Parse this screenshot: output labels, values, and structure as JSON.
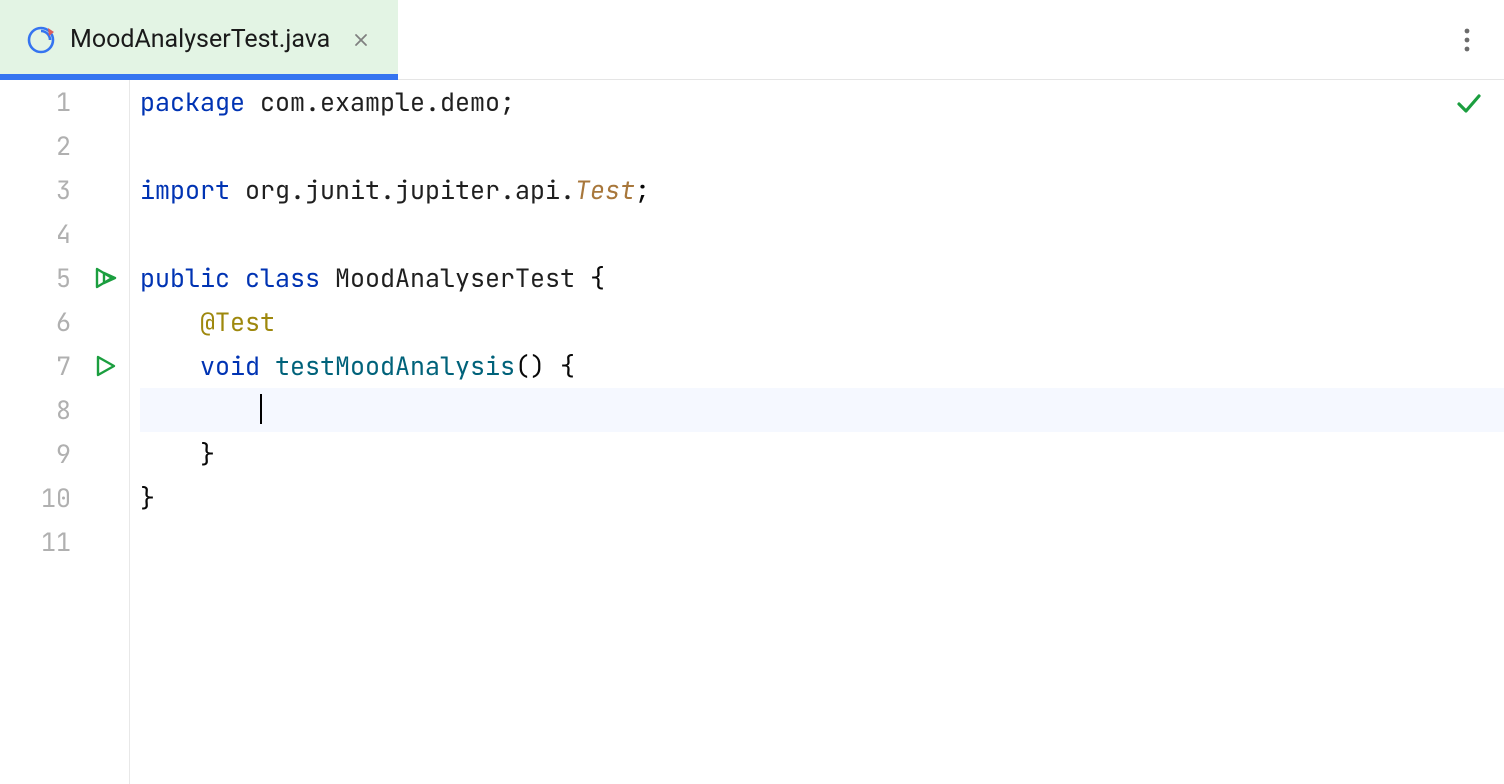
{
  "tab": {
    "title": "MoodAnalyserTest.java"
  },
  "gutter": {
    "lines": [
      "1",
      "2",
      "3",
      "4",
      "5",
      "6",
      "7",
      "8",
      "9",
      "10",
      "11"
    ]
  },
  "code": {
    "l1_kw": "package",
    "l1_rest": " com.example.demo;",
    "l3_kw": "import",
    "l3_mid": " org.junit.jupiter.api.",
    "l3_cls": "Test",
    "l3_semi": ";",
    "l5_pub": "public ",
    "l5_class": "class",
    "l5_name": " MoodAnalyserTest ",
    "l5_brace": "{",
    "l6_indent": "    ",
    "l6_ann": "@Test",
    "l7_indent": "    ",
    "l7_void": "void ",
    "l7_name": "testMoodAnalysis",
    "l7_rest": "() {",
    "l8_indent": "        ",
    "l9_indent": "    ",
    "l9_brace": "}",
    "l10_brace": "}"
  }
}
